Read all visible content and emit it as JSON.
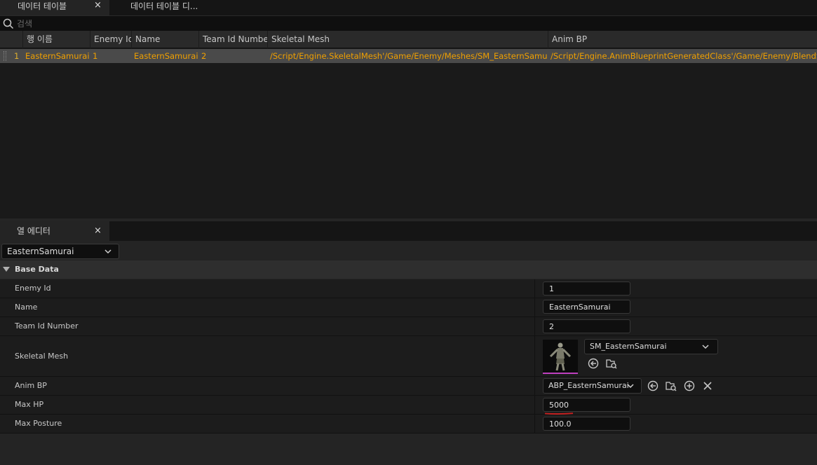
{
  "tabs": [
    {
      "label": "데이터 테이블",
      "active": true,
      "close": "×"
    },
    {
      "label": "데이터 테이블 디...",
      "active": false
    }
  ],
  "search": {
    "placeholder": "검색"
  },
  "table": {
    "columns": [
      "행 이름",
      "Enemy Id",
      "Name",
      "Team Id Number",
      "Skeletal Mesh",
      "Anim BP"
    ],
    "rows": [
      {
        "index": "1",
        "row_name": "EasternSamurai",
        "enemy_id": "1",
        "name": "EasternSamurai",
        "team_id": "2",
        "skeletal_mesh": "/Script/Engine.SkeletalMesh'/Game/Enemy/Meshes/SM_EasternSamurai",
        "anim_bp": "/Script/Engine.AnimBlueprintGeneratedClass'/Game/Enemy/BlendSpa"
      }
    ]
  },
  "row_editor": {
    "tab_label": "열 에디터",
    "close": "×",
    "selected_row": "EasternSamurai",
    "section": "Base Data",
    "props": {
      "enemy_id": {
        "label": "Enemy Id",
        "value": "1"
      },
      "name": {
        "label": "Name",
        "value": "EasternSamurai"
      },
      "team_id": {
        "label": "Team Id Number",
        "value": "2"
      },
      "skeletal_mesh": {
        "label": "Skeletal Mesh",
        "value": "SM_EasternSamurai"
      },
      "anim_bp": {
        "label": "Anim BP",
        "value": "ABP_EasternSamurai"
      },
      "max_hp": {
        "label": "Max HP",
        "value": "5000"
      },
      "max_posture": {
        "label": "Max Posture",
        "value": "100.0"
      }
    }
  },
  "colors": {
    "accent_orange": "#f0a000",
    "thumb_underline": "#c040c0",
    "annotation_red": "#cc2020"
  },
  "icons": [
    "close-icon",
    "search-icon",
    "chevron-down-icon",
    "use-selected-icon",
    "browse-icon",
    "add-icon",
    "clear-icon"
  ]
}
